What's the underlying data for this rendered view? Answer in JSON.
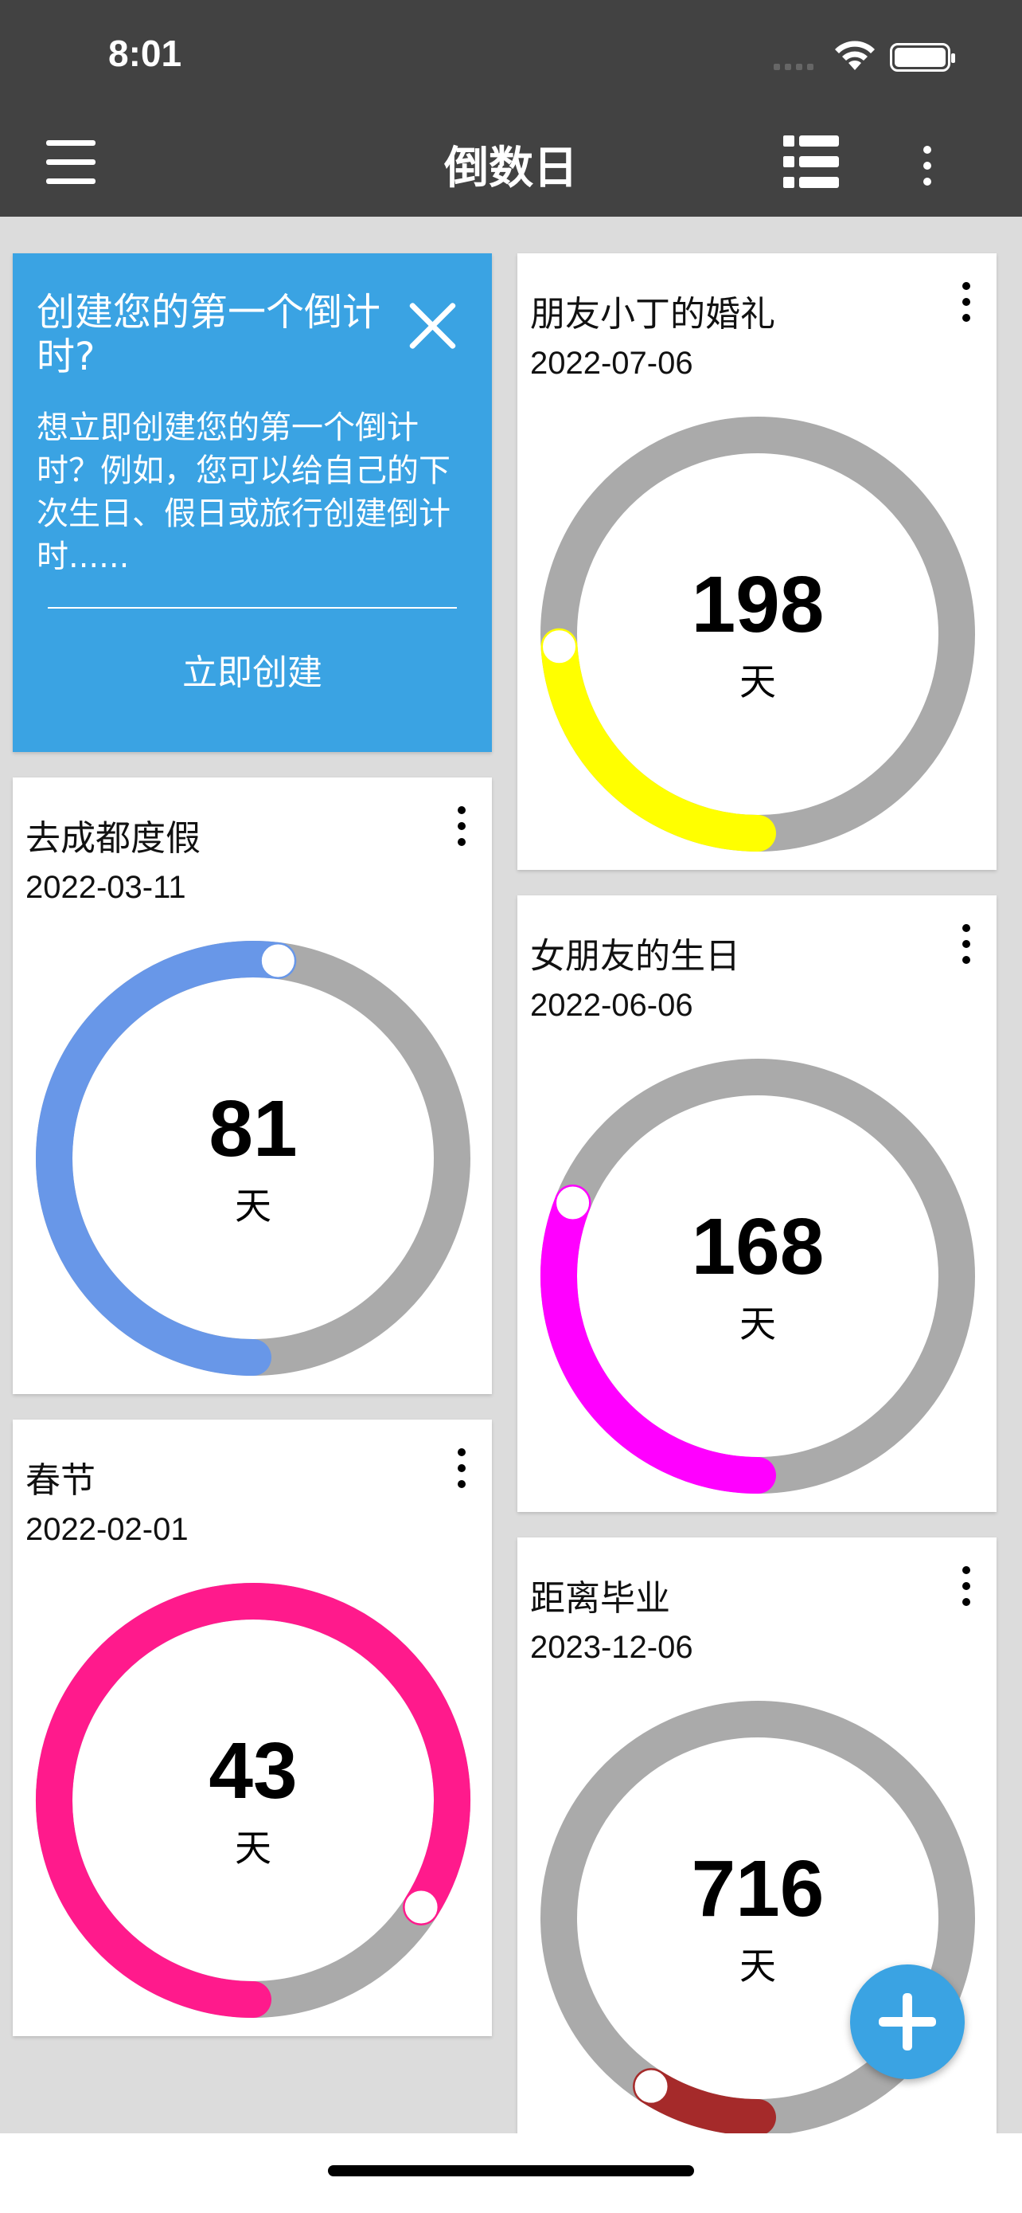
{
  "status_bar": {
    "time": "8:01"
  },
  "app_bar": {
    "title": "倒数日"
  },
  "promo": {
    "title": "创建您的第一个倒计时?",
    "body": "想立即创建您的第一个倒计时？例如，您可以给自己的下次生日、假日或旅行创建倒计时......",
    "cta": "立即创建"
  },
  "unit": "天",
  "cards": [
    {
      "title": "去成都度假",
      "date": "2022-03-11",
      "days": "81",
      "progress": 0.52,
      "color": "#6897e8"
    },
    {
      "title": "春节",
      "date": "2022-02-01",
      "days": "43",
      "progress": 0.84,
      "color": "#ff1a8c"
    },
    {
      "title": "朋友小丁的婚礼",
      "date": "2022-07-06",
      "days": "198",
      "progress": 0.24,
      "color": "#ffff00"
    },
    {
      "title": "女朋友的生日",
      "date": "2022-06-06",
      "days": "168",
      "progress": 0.31,
      "color": "#ff00ff"
    },
    {
      "title": "距离毕业",
      "date": "2023-12-06",
      "days": "716",
      "progress": 0.09,
      "color": "#a52a2a"
    }
  ],
  "colors": {
    "ring_track": "#aaaaaa",
    "accent": "#3aa3e3",
    "app_bar": "#424242"
  },
  "icons": [
    "menu-icon",
    "list-view-icon",
    "more-vert-icon",
    "close-icon",
    "add-icon",
    "wifi-icon",
    "battery-icon"
  ]
}
